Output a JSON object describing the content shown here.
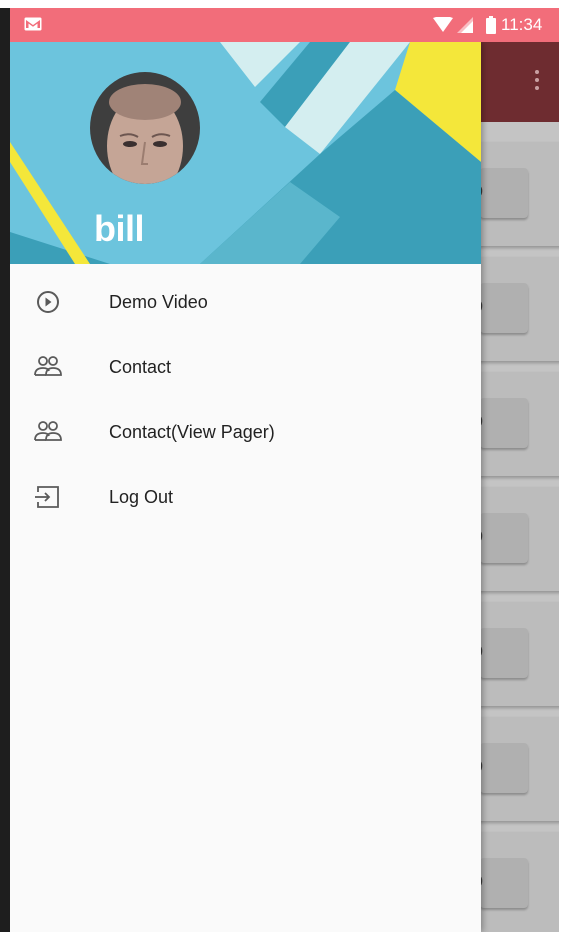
{
  "status_bar": {
    "time": "11:34",
    "icons": [
      "gmail-icon",
      "wifi-icon",
      "signal-icon",
      "battery-icon"
    ],
    "background_color": "#f26d7a"
  },
  "drawer": {
    "header": {
      "username": "bill",
      "colors": {
        "sky": "#6cc4dd",
        "teal": "#3b9fb8",
        "light": "#d4eef0",
        "yellow": "#f4e73a"
      }
    },
    "menu": [
      {
        "icon": "play-circle-icon",
        "label": "Demo Video"
      },
      {
        "icon": "people-icon",
        "label": "Contact"
      },
      {
        "icon": "people-icon",
        "label": "Contact(View Pager)"
      },
      {
        "icon": "logout-icon",
        "label": "Log Out"
      }
    ]
  },
  "background_app": {
    "toolbar_color": "#6e2c30",
    "card_letter": "b"
  }
}
